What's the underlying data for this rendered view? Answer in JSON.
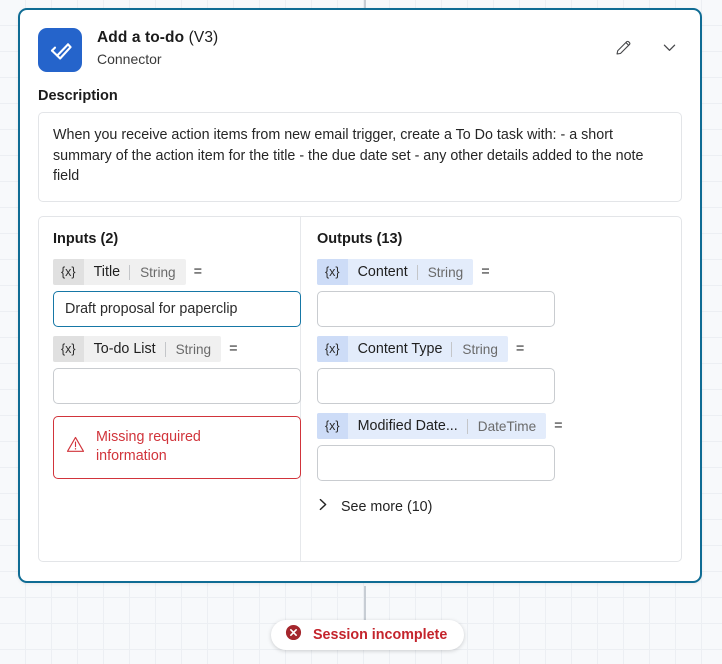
{
  "card": {
    "icon_name": "checkmark-icon",
    "icon_color": "#2564CB",
    "border_color": "#0F6C94",
    "title": "Add a to-do",
    "title_version": "(V3)",
    "subtitle": "Connector",
    "edit_icon": "pencil-icon",
    "collapse_icon": "chevron-down-icon"
  },
  "description": {
    "label": "Description",
    "text": "When you receive action items from new email trigger, create a To Do task with: - a short summary of the action item for the title - the due date set - any other details added to the note field"
  },
  "inputs": {
    "heading": "Inputs (2)",
    "fields": [
      {
        "token": "{x}",
        "name": "Title",
        "type": "String",
        "equals": "=",
        "value": "Draft proposal for paperclip",
        "focused": true
      },
      {
        "token": "{x}",
        "name": "To-do List",
        "type": "String",
        "equals": "=",
        "value": "",
        "focused": false
      }
    ],
    "error": {
      "icon": "warning-triangle-icon",
      "text": "Missing required information",
      "color": "#D1343B"
    }
  },
  "outputs": {
    "heading": "Outputs (13)",
    "fields": [
      {
        "token": "{x}",
        "name": "Content",
        "type": "String",
        "equals": "=",
        "value": ""
      },
      {
        "token": "{x}",
        "name": "Content Type",
        "type": "String",
        "equals": "=",
        "value": ""
      },
      {
        "token": "{x}",
        "name": "Modified Date...",
        "type": "DateTime",
        "equals": "=",
        "value": ""
      }
    ],
    "see_more": {
      "icon": "chevron-right-icon",
      "label": "See more (10)"
    }
  },
  "status": {
    "icon": "error-circle-icon",
    "label": "Session incomplete",
    "color": "#C4242C",
    "icon_color": "#A4262C"
  }
}
